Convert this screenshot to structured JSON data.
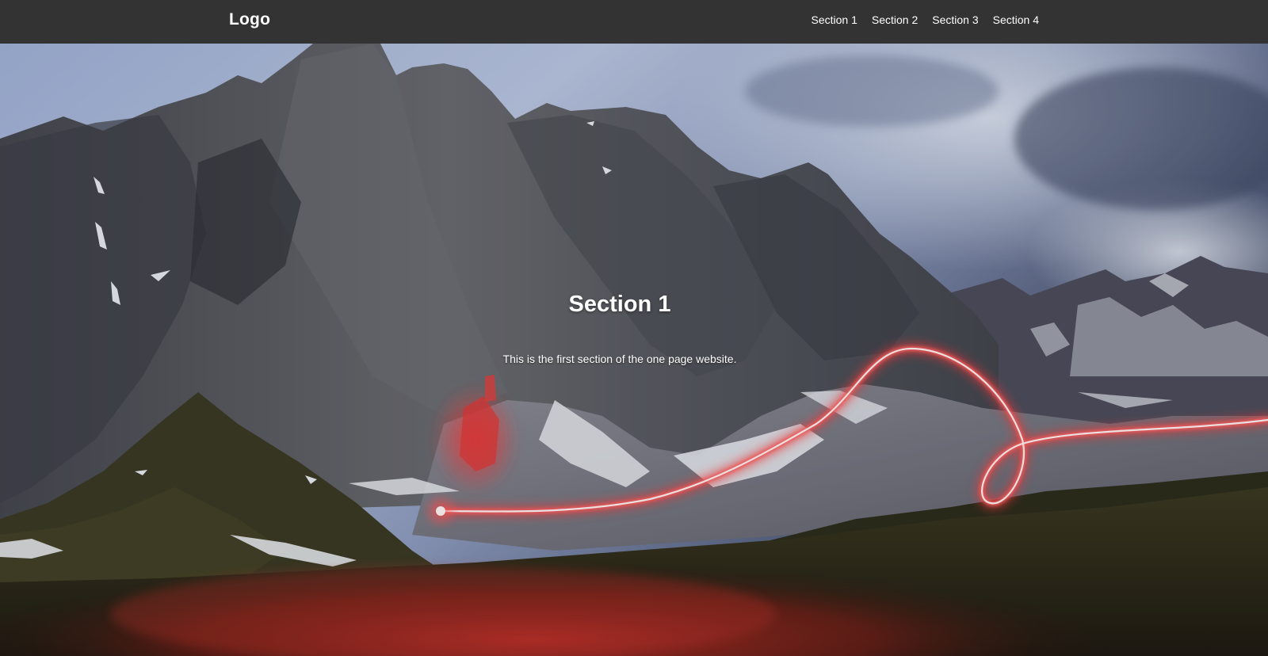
{
  "header": {
    "logo": "Logo",
    "nav": [
      {
        "label": "Section 1"
      },
      {
        "label": "Section 2"
      },
      {
        "label": "Section 3"
      },
      {
        "label": "Section 4"
      }
    ],
    "background_color": "#333333"
  },
  "hero": {
    "title": "Section 1",
    "text": "This is the first section of the one page website.",
    "background_image": "mountain-night-light-trail-photo"
  }
}
